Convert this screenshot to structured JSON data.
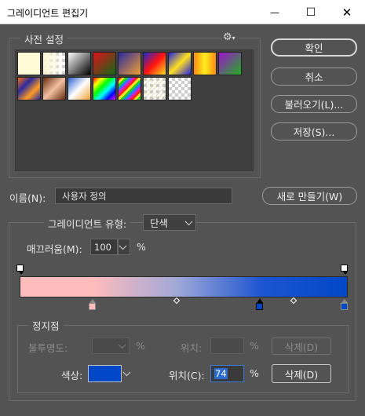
{
  "window": {
    "title": "그레이디언트 편집기",
    "minimize": "—",
    "maximize": "☐",
    "close": "✕"
  },
  "presets": {
    "legend": "사전 설정",
    "gear": "⚙",
    "gear_arrow": "▾"
  },
  "buttons": {
    "ok": "확인",
    "cancel": "취소",
    "load": "불러오기(L)...",
    "save": "저장(S)...",
    "new": "새로 만들기(W)"
  },
  "name": {
    "label": "이름(N):",
    "value": "사용자 정의"
  },
  "type": {
    "label": "그레이디언트 유형:",
    "value": "단색"
  },
  "smoothness": {
    "label": "매끄러움(M):",
    "value": "100",
    "unit": "%"
  },
  "stops": {
    "legend": "정지점",
    "opacity_label": "불투명도:",
    "opacity_unit": "%",
    "opacity_location_label": "위치:",
    "opacity_location_unit": "%",
    "opacity_delete": "삭제(D)",
    "color_label": "색상:",
    "color_location_label": "위치(C):",
    "color_location_value": "74",
    "color_location_unit": "%",
    "color_delete": "삭제(D)"
  },
  "colors": {
    "start": "#ffbcbc",
    "end": "#0048c8",
    "selected_stop": "#0048c8",
    "first_stop": "#ffbcbc"
  }
}
